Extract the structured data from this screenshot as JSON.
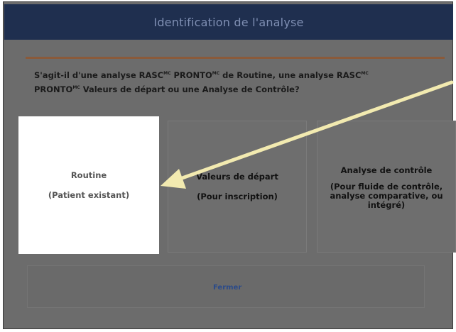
{
  "dialog": {
    "title": "Identification de l'analyse",
    "question_part1": "S'agit-il d'une analyse RASC",
    "question_sup1": "MC",
    "question_part2": " PRONTO",
    "question_sup2": "MC",
    "question_part3": " de Routine, une analyse RASC",
    "question_sup3": "MC",
    "question_part4": "PRONTO",
    "question_sup4": "MC",
    "question_part5": " Valeurs de départ ou une Analyse de Contrôle?"
  },
  "options": [
    {
      "title": "Routine",
      "subtitle": "(Patient existant)"
    },
    {
      "title": "Valeurs de départ",
      "subtitle": "(Pour inscription)"
    },
    {
      "title": "Analyse de contrôle",
      "subtitle": "(Pour fluide de contrôle, analyse comparative, ou intégré)"
    }
  ],
  "footer": {
    "close_label": "Fermer"
  },
  "colors": {
    "title_bar": "#1f2f4f",
    "accent_line": "#8a5a3a",
    "arrow": "#f2eab0",
    "overlay": "#6c6c6c",
    "selected_card": "#ffffff"
  },
  "annotation": {
    "type": "arrow",
    "color": "#f2eab0",
    "points_to": "routine-option"
  }
}
